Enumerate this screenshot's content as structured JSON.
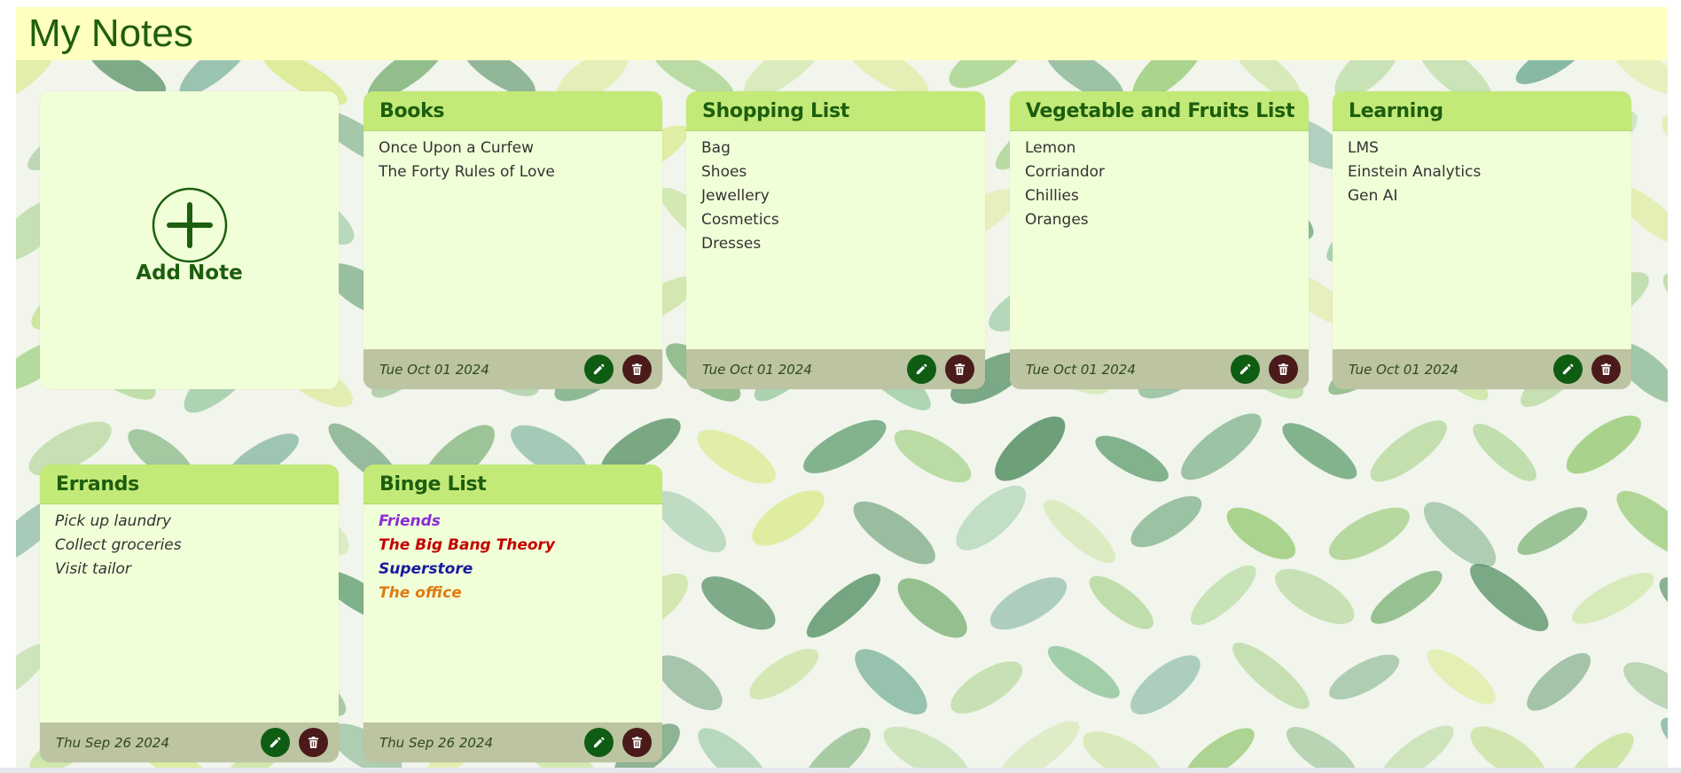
{
  "header": {
    "title": "My Notes"
  },
  "add_note": {
    "label": "Add Note"
  },
  "colors": {
    "header_bg": "#ffffc2",
    "card_head_bg": "#c3ea78",
    "card_body_bg": "#f1ffd8",
    "card_foot_bg": "#bcc4a2",
    "edit_button": "#0f5c13",
    "delete_button": "#4b1a1a"
  },
  "notes": [
    {
      "title": "Books",
      "lines": [
        "Once Upon a Curfew",
        "The Forty Rules of Love"
      ],
      "date": "Tue Oct 01 2024"
    },
    {
      "title": "Shopping List",
      "lines": [
        "Bag",
        "Shoes",
        "Jewellery",
        "Cosmetics",
        "Dresses"
      ],
      "date": "Tue Oct 01 2024"
    },
    {
      "title": "Vegetable and Fruits List",
      "lines": [
        "Lemon",
        "Corriandor",
        "Chillies",
        "Oranges"
      ],
      "date": "Tue Oct 01 2024"
    },
    {
      "title": "Learning",
      "lines": [
        "LMS",
        "Einstein Analytics",
        "Gen AI"
      ],
      "date": "Tue Oct 01 2024"
    },
    {
      "title": "Errands",
      "lines": [
        "Pick up laundry",
        "Collect groceries",
        "Visit tailor"
      ],
      "date": "Thu Sep 26 2024",
      "italic": true
    },
    {
      "title": "Binge List",
      "lines": [
        "Friends",
        "The Big Bang Theory",
        "Superstore",
        "The office"
      ],
      "line_colors": [
        "#8a2bd6",
        "#c40000",
        "#1a1aa0",
        "#e07a10"
      ],
      "bold_italic": true,
      "date": "Thu Sep 26 2024"
    }
  ],
  "icons": {
    "add": "add-circle-icon",
    "edit": "pencil-icon",
    "delete": "trash-icon"
  }
}
